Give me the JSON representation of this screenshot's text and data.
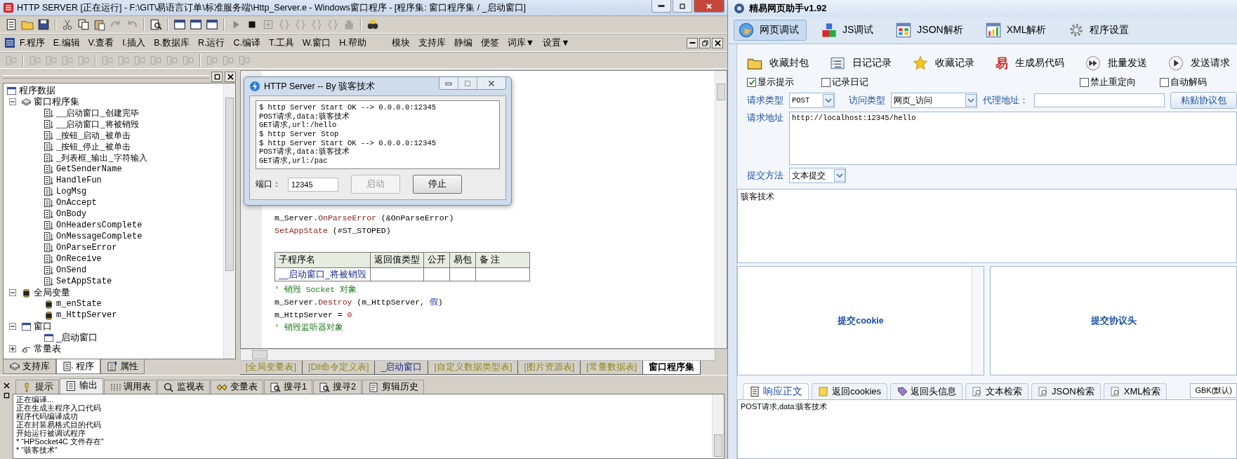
{
  "ide": {
    "title": "HTTP SERVER [正在运行] - F:\\GIT\\易语言订单\\标准服务端\\Http_Server.e - Windows窗口程序 - [程序集: 窗口程序集 / _启动窗口]",
    "menu": [
      "F.程序",
      "E.编辑",
      "V.查看",
      "I.插入",
      "B.数据库",
      "R.运行",
      "C.编译",
      "T.工具",
      "W.窗口",
      "H.帮助",
      "模块",
      "支持库",
      "静编",
      "便签",
      "词库▼",
      "设置▼"
    ],
    "tree": [
      {
        "label": "程序数据",
        "kind": "root",
        "children": [
          {
            "label": "窗口程序集",
            "kind": "module",
            "expanded": true,
            "children": [
              {
                "label": "__启动窗口_创建完毕",
                "kind": "sub"
              },
              {
                "label": "__启动窗口_将被销毁",
                "kind": "sub"
              },
              {
                "label": "_按钮_启动_被单击",
                "kind": "sub"
              },
              {
                "label": "_按钮_停止_被单击",
                "kind": "sub"
              },
              {
                "label": "_列表框_输出_字符输入",
                "kind": "sub"
              },
              {
                "label": "GetSenderName",
                "kind": "sub"
              },
              {
                "label": "HandleFun",
                "kind": "sub"
              },
              {
                "label": "LogMsg",
                "kind": "sub"
              },
              {
                "label": "OnAccept",
                "kind": "sub"
              },
              {
                "label": "OnBody",
                "kind": "sub"
              },
              {
                "label": "OnHeadersComplete",
                "kind": "sub"
              },
              {
                "label": "OnMessageComplete",
                "kind": "sub"
              },
              {
                "label": "OnParseError",
                "kind": "sub"
              },
              {
                "label": "OnReceive",
                "kind": "sub"
              },
              {
                "label": "OnSend",
                "kind": "sub"
              },
              {
                "label": "SetAppState",
                "kind": "sub"
              }
            ]
          },
          {
            "label": "全局变量",
            "kind": "globals",
            "expanded": true,
            "children": [
              {
                "label": "m_enState",
                "kind": "var"
              },
              {
                "label": "m_HttpServer",
                "kind": "var"
              }
            ]
          },
          {
            "label": "窗口",
            "kind": "forms",
            "expanded": true,
            "children": [
              {
                "label": "_启动窗口",
                "kind": "form"
              }
            ]
          },
          {
            "label": "常量表",
            "kind": "consts",
            "expanded": false
          }
        ]
      }
    ],
    "panel_tabs": [
      {
        "label": "支持库",
        "kind": "lib",
        "selected": false
      },
      {
        "label": "程序",
        "kind": "program",
        "selected": true
      },
      {
        "label": "属性",
        "kind": "props",
        "selected": false
      }
    ],
    "code": [
      {
        "kind": "line",
        "segments": [
          {
            "text": "m_Server.",
            "kind": "text"
          },
          {
            "text": "OnParseError",
            "kind": "method"
          },
          {
            "text": " (&OnParseError)",
            "kind": "text"
          }
        ]
      },
      {
        "kind": "line",
        "segments": [
          {
            "text": "SetAppState",
            "kind": "method"
          },
          {
            "text": " (#ST_STOPED)",
            "kind": "text"
          }
        ]
      },
      {
        "kind": "table",
        "columns": [
          "子程序名",
          "返回值类型",
          "公开",
          "易包",
          "备 注"
        ],
        "rows": [
          {
            "name": "__启动窗口_将被销毁"
          }
        ]
      },
      {
        "kind": "line",
        "segments": [
          {
            "text": "' 销毁 Socket 对象",
            "kind": "comment"
          }
        ]
      },
      {
        "kind": "line",
        "segments": [
          {
            "text": "m_Server.",
            "kind": "text"
          },
          {
            "text": "Destroy",
            "kind": "method"
          },
          {
            "text": " (m_HttpServer, ",
            "kind": "text"
          },
          {
            "text": "假",
            "kind": "constant"
          },
          {
            "text": ")",
            "kind": "text"
          }
        ]
      },
      {
        "kind": "line",
        "segments": [
          {
            "text": "m_HttpServer = ",
            "kind": "text"
          },
          {
            "text": "0",
            "kind": "number"
          }
        ]
      },
      {
        "kind": "line",
        "segments": [
          {
            "text": "' 销毁监听器对象",
            "kind": "comment"
          }
        ]
      }
    ],
    "editor_tabs": [
      {
        "label": "[全局变量表]",
        "kind": "sheet",
        "selected": false
      },
      {
        "label": "[Dll命令定义表]",
        "kind": "sheet",
        "selected": false
      },
      {
        "label": "_启动窗口",
        "kind": "form",
        "selected": false
      },
      {
        "label": "[自定义数据类型表]",
        "kind": "sheet",
        "selected": false
      },
      {
        "label": "[图片资源表]",
        "kind": "sheet",
        "selected": false
      },
      {
        "label": "[常量数据表]",
        "kind": "sheet",
        "selected": false
      },
      {
        "label": "窗口程序集",
        "kind": "module",
        "selected": true
      }
    ],
    "output_tabs": [
      {
        "label": "提示",
        "kind": "hint",
        "selected": false
      },
      {
        "label": "输出",
        "kind": "output",
        "selected": true
      },
      {
        "label": "调用表",
        "kind": "calls",
        "selected": false
      },
      {
        "label": "监视表",
        "kind": "watch",
        "selected": false
      },
      {
        "label": "变量表",
        "kind": "vars",
        "selected": false
      },
      {
        "label": "搜寻1",
        "kind": "find",
        "selected": false
      },
      {
        "label": "搜寻2",
        "kind": "find",
        "selected": false
      },
      {
        "label": "剪辑历史",
        "kind": "clip",
        "selected": false
      }
    ],
    "output_lines": [
      "正在编译...",
      "正在生成主程序入口代码",
      "程序代码编译成功",
      "正在封装易格式目的代码",
      "开始运行被调试程序",
      "* “HPSocket4C 文件存在”",
      "* “骇客技术”"
    ],
    "dialog": {
      "title": "HTTP Server -- By 骇客技术",
      "log": [
        "$ http Server Start OK --> 0.0.0.0:12345",
        "POST请求,data:骇客技术",
        "GET请求,url:/hello",
        "$ http Server Stop",
        "$ http Server Start OK --> 0.0.0.0:12345",
        "POST请求,data:骇客技术",
        "GET请求,url:/pac"
      ],
      "port_label": "端口：",
      "port": "12345",
      "buttons": [
        {
          "label": "启动",
          "disabled": true
        },
        {
          "label": "停止",
          "disabled": false
        }
      ]
    }
  },
  "helper": {
    "title": "精易网页助手v1.92",
    "tabs": [
      {
        "label": "网页调试",
        "kind": "globe",
        "selected": true
      },
      {
        "label": "JS调试",
        "kind": "cubes",
        "selected": false
      },
      {
        "label": "JSON解析",
        "kind": "grid",
        "selected": false
      },
      {
        "label": "XML解析",
        "kind": "chart",
        "selected": false
      },
      {
        "label": "程序设置",
        "kind": "gear",
        "selected": false
      }
    ],
    "actions": [
      {
        "label": "收藏封包",
        "kind": "folder"
      },
      {
        "label": "日记记录",
        "kind": "list"
      },
      {
        "label": "收藏记录",
        "kind": "star"
      },
      {
        "label": "生成易代码",
        "kind": "glyph",
        "glyph": "易"
      },
      {
        "label": "批量发送",
        "kind": "forward"
      },
      {
        "label": "发送请求",
        "kind": "play"
      }
    ],
    "options": [
      {
        "label": "显示提示",
        "checked": true
      },
      {
        "label": "记录日记",
        "checked": false
      },
      {
        "label": "禁止重定向",
        "checked": false
      },
      {
        "label": "自动解码",
        "checked": false
      }
    ],
    "request_type": {
      "label": "请求类型",
      "value": "POST"
    },
    "access_type": {
      "label": "访问类型",
      "value": "网页_访问"
    },
    "proxy": {
      "label": "代理地址："
    },
    "paste_button": "粘贴协议包",
    "url": {
      "label": "请求地址",
      "value": "http://localhost:12345/hello"
    },
    "method": {
      "label": "提交方法",
      "value": "文本提交"
    },
    "post_data": "骇客技术",
    "cookie_panel": "提交cookie",
    "header_panel": "提交协议头",
    "result_tabs": [
      {
        "label": "响应正文",
        "kind": "doc",
        "selected": true
      },
      {
        "label": "返回cookies",
        "kind": "note",
        "selected": false
      },
      {
        "label": "返回头信息",
        "kind": "tag",
        "selected": false
      },
      {
        "label": "文本检索",
        "kind": "search",
        "selected": false
      },
      {
        "label": "JSON检索",
        "kind": "search",
        "selected": false
      },
      {
        "label": "XML检索",
        "kind": "search",
        "selected": false
      }
    ],
    "encoding": "GBK(默认)",
    "response": "POST请求,data:骇客技术"
  }
}
